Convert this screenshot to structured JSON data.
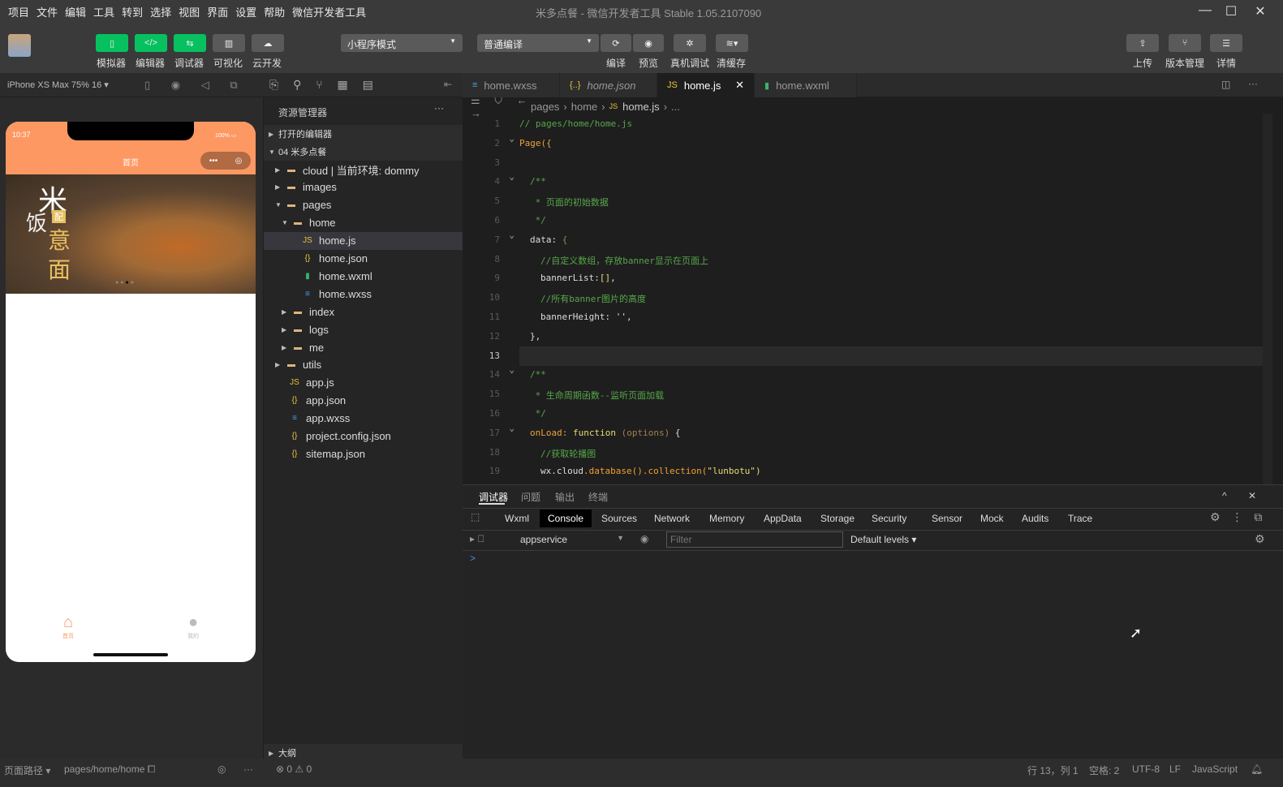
{
  "menu": [
    "项目",
    "文件",
    "编辑",
    "工具",
    "转到",
    "选择",
    "视图",
    "界面",
    "设置",
    "帮助",
    "微信开发者工具"
  ],
  "window_title": "米多点餐 - 微信开发者工具 Stable 1.05.2107090",
  "toolbar": {
    "left": [
      {
        "icon": "phone-icon",
        "label": "模拟器",
        "active": true
      },
      {
        "icon": "code-icon",
        "label": "编辑器",
        "active": true
      },
      {
        "icon": "debug-icon",
        "label": "调试器",
        "active": true
      },
      {
        "icon": "layout-icon",
        "label": "可视化",
        "active": false
      },
      {
        "icon": "cloud-icon",
        "label": "云开发",
        "active": false
      }
    ],
    "mode": "小程序模式",
    "compile": "普通编译",
    "mid": [
      "编译",
      "预览",
      "真机调试",
      "清缓存"
    ],
    "right": [
      "上传",
      "版本管理",
      "详情"
    ]
  },
  "device": "iPhone XS Max 75% 16",
  "tabs": [
    {
      "label": "home.wxss",
      "icon": "css-icon"
    },
    {
      "label": "home.json",
      "icon": "json-icon"
    },
    {
      "label": "home.js",
      "icon": "js-icon",
      "active": true
    },
    {
      "label": "home.wxml",
      "icon": "wxml-icon"
    }
  ],
  "phone": {
    "time": "10:37",
    "battery": "100%",
    "title": "首页",
    "banner_text": [
      "米",
      "饭",
      "配",
      "意",
      "面"
    ],
    "nav": [
      {
        "label": "首页",
        "icon": "home-icon",
        "active": true
      },
      {
        "label": "我的",
        "icon": "user-icon"
      }
    ]
  },
  "explorer": {
    "title": "资源管理器",
    "open_editors": "打开的编辑器",
    "project": "04 米多点餐",
    "outline": "大纲",
    "items": [
      {
        "label": "cloud | 当前环境: dommy",
        "depth": 1,
        "type": "folder",
        "open": false
      },
      {
        "label": "images",
        "depth": 1,
        "type": "folder",
        "open": false
      },
      {
        "label": "pages",
        "depth": 1,
        "type": "folder",
        "open": true
      },
      {
        "label": "home",
        "depth": 2,
        "type": "folder",
        "open": true
      },
      {
        "label": "home.js",
        "depth": 3,
        "type": "js",
        "selected": true
      },
      {
        "label": "home.json",
        "depth": 3,
        "type": "json"
      },
      {
        "label": "home.wxml",
        "depth": 3,
        "type": "wxml"
      },
      {
        "label": "home.wxss",
        "depth": 3,
        "type": "wxss"
      },
      {
        "label": "index",
        "depth": 2,
        "type": "folder",
        "open": false
      },
      {
        "label": "logs",
        "depth": 2,
        "type": "folder",
        "open": false
      },
      {
        "label": "me",
        "depth": 2,
        "type": "folder",
        "open": false
      },
      {
        "label": "utils",
        "depth": 1,
        "type": "folder",
        "open": false
      },
      {
        "label": "app.js",
        "depth": 1,
        "type": "js"
      },
      {
        "label": "app.json",
        "depth": 1,
        "type": "json"
      },
      {
        "label": "app.wxss",
        "depth": 1,
        "type": "wxss"
      },
      {
        "label": "project.config.json",
        "depth": 1,
        "type": "json"
      },
      {
        "label": "sitemap.json",
        "depth": 1,
        "type": "json"
      }
    ]
  },
  "breadcrumb": [
    "pages",
    "home",
    "home.js",
    "..."
  ],
  "code": [
    {
      "i": 0,
      "t": [
        [
          "// pages/home/home.js",
          "c"
        ]
      ]
    },
    {
      "i": 0,
      "t": [
        [
          "Page({",
          "k"
        ]
      ]
    },
    {
      "i": 0,
      "t": []
    },
    {
      "i": 1,
      "t": [
        [
          "/**",
          "c"
        ]
      ]
    },
    {
      "i": 1,
      "t": [
        [
          " * 页面的初始数据",
          "c"
        ]
      ]
    },
    {
      "i": 1,
      "t": [
        [
          " */",
          "c"
        ]
      ]
    },
    {
      "i": 1,
      "t": [
        [
          "data: ",
          "p"
        ],
        [
          "{",
          "o"
        ]
      ]
    },
    {
      "i": 2,
      "t": [
        [
          "//自定义数组，存放banner显示在页面上",
          "c"
        ]
      ]
    },
    {
      "i": 2,
      "t": [
        [
          "bannerList:",
          "p"
        ],
        [
          "[]",
          "s"
        ],
        [
          ",",
          "p"
        ]
      ]
    },
    {
      "i": 2,
      "t": [
        [
          "//所有banner图片的高度",
          "c"
        ]
      ]
    },
    {
      "i": 2,
      "t": [
        [
          "bannerHeight: '',",
          "p"
        ]
      ]
    },
    {
      "i": 1,
      "t": [
        [
          "},",
          "p"
        ]
      ]
    },
    {
      "i": 0,
      "t": []
    },
    {
      "i": 1,
      "t": [
        [
          "/**",
          "c"
        ]
      ]
    },
    {
      "i": 1,
      "t": [
        [
          " * 生命周期函数--监听页面加载",
          "c"
        ]
      ]
    },
    {
      "i": 1,
      "t": [
        [
          " */",
          "c"
        ]
      ]
    },
    {
      "i": 1,
      "t": [
        [
          "onLoad: ",
          "k"
        ],
        [
          "function ",
          "s"
        ],
        [
          "(options) ",
          "o"
        ],
        [
          "{",
          "p"
        ]
      ]
    },
    {
      "i": 2,
      "t": [
        [
          "//获取轮播图",
          "c"
        ]
      ]
    },
    {
      "i": 2,
      "t": [
        [
          "wx.",
          "p"
        ],
        [
          "cloud",
          "p"
        ],
        [
          ".database().collection(",
          "f"
        ],
        [
          "\"lunbotu\"",
          "s"
        ],
        [
          ")",
          "s"
        ]
      ]
    }
  ],
  "current_line": 13,
  "devtools": {
    "panels": [
      "调试器",
      "问题",
      "输出",
      "终端"
    ],
    "tabs": [
      "Wxml",
      "Console",
      "Sources",
      "Network",
      "Memory",
      "AppData",
      "Storage",
      "Security",
      "Sensor",
      "Mock",
      "Audits",
      "Trace"
    ],
    "active_tab": "Console",
    "context": "appservice",
    "filter_placeholder": "Filter",
    "levels": "Default levels",
    "prompt": ">"
  },
  "status": {
    "page_path_label": "页面路径",
    "page_path": "pages/home/home",
    "errors": "0",
    "warnings": "0",
    "position": "行 13，列 1",
    "spaces": "空格: 2",
    "encoding": "UTF-8",
    "eol": "LF",
    "language": "JavaScript"
  }
}
